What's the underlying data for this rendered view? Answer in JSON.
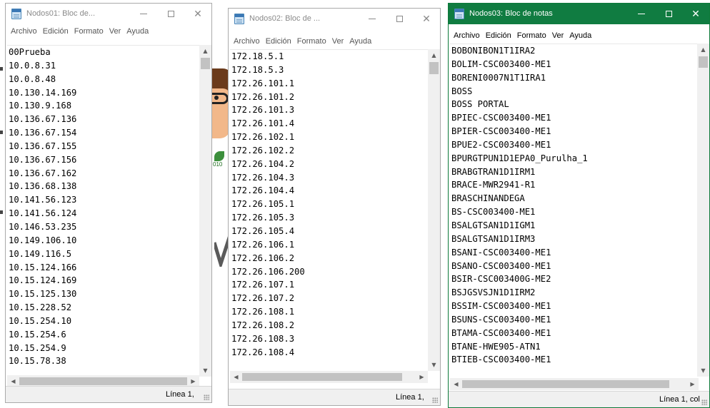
{
  "menu": [
    "Archivo",
    "Edición",
    "Formato",
    "Ver",
    "Ayuda"
  ],
  "windows": [
    {
      "title": "Nodos01: Bloc de...",
      "status": "Línea 1,",
      "lines": [
        "00Prueba",
        "10.0.8.31",
        "10.0.8.48",
        "10.130.14.169",
        "10.130.9.168",
        "10.136.67.136",
        "10.136.67.154",
        "10.136.67.155",
        "10.136.67.156",
        "10.136.67.162",
        "10.136.68.138",
        "10.141.56.123",
        "10.141.56.124",
        "10.146.53.235",
        "10.149.106.10",
        "10.149.116.5",
        "10.15.124.166",
        "10.15.124.169",
        "10.15.125.130",
        "10.15.228.52",
        "10.15.254.10",
        "10.15.254.6",
        "10.15.254.9",
        "10.15.78.38"
      ]
    },
    {
      "title": "Nodos02: Bloc de ...",
      "status": "Línea 1,",
      "lines": [
        "172.18.5.1",
        "172.18.5.3",
        "172.26.101.1",
        "172.26.101.2",
        "172.26.101.3",
        "172.26.101.4",
        "172.26.102.1",
        "172.26.102.2",
        "172.26.104.2",
        "172.26.104.3",
        "172.26.104.4",
        "172.26.105.1",
        "172.26.105.3",
        "172.26.105.4",
        "172.26.106.1",
        "172.26.106.2",
        "172.26.106.200",
        "172.26.107.1",
        "172.26.107.2",
        "172.26.108.1",
        "172.26.108.2",
        "172.26.108.3",
        "172.26.108.4"
      ]
    },
    {
      "title": "Nodos03: Bloc de notas",
      "status": "Línea 1, col",
      "lines": [
        "BOBONIBON1T1IRA2",
        "BOLIM-CSC003400-ME1",
        "BORENI0007N1T1IRA1",
        "BOSS",
        "BOSS PORTAL",
        "BPIEC-CSC003400-ME1",
        "BPIER-CSC003400-ME1",
        "BPUE2-CSC003400-ME1",
        "BPURGTPUN1D1EPA0_Purulha_1",
        "BRABGTRAN1D1IRM1",
        "BRACE-MWR2941-R1",
        "BRASCHINANDEGA",
        "BS-CSC003400-ME1",
        "BSALGTSAN1D1IGM1",
        "BSALGTSAN1D1IRM3",
        "BSANI-CSC003400-ME1",
        "BSANO-CSC003400-ME1",
        "BSIR-CSC003400G-ME2",
        "BSJGSVSJN1D1IRM2",
        "BSSIM-CSC003400-ME1",
        "BSUNS-CSC003400-ME1",
        "BTAMA-CSC003400-ME1",
        "BTANE-HWE905-ATN1",
        "BTIEB-CSC003400-ME1"
      ]
    }
  ],
  "background": {
    "text": "010"
  },
  "colors": {
    "active_titlebar": "#107c41",
    "inactive_title_text": "#8a8a8a"
  },
  "icons": {
    "app": "notepad-icon",
    "minimize": "minimize-icon",
    "maximize": "maximize-icon",
    "close": "close-icon"
  }
}
